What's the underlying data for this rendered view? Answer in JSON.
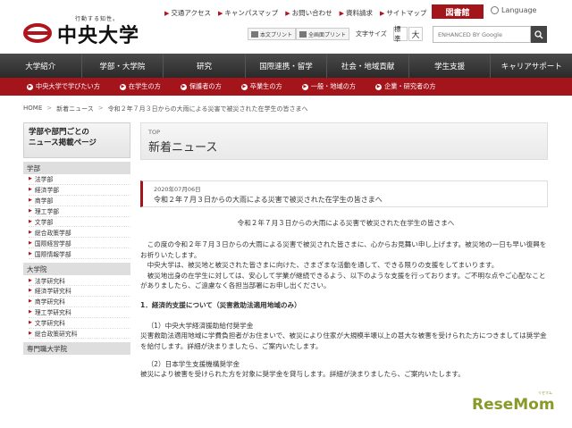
{
  "header": {
    "slogan": "行動する知性。",
    "university_name": "中央大学",
    "top_links": [
      "交通アクセス",
      "キャンパスマップ",
      "お問い合わせ",
      "資料請求",
      "サイトマップ"
    ],
    "library_button": "図書館",
    "language": "Language",
    "print_text_only": "本文プリント",
    "print_full": "全画面プリント",
    "font_size_label": "文字サイズ",
    "font_size_standard": "標準",
    "font_size_large": "大",
    "search_placeholder": "ENHANCED BY Google",
    "accent_color": "#a4141b"
  },
  "main_nav": [
    "大学紹介",
    "学部・大学院",
    "研究",
    "国際連携・留学",
    "社会・地域貢献",
    "学生支援",
    "キャリアサポート"
  ],
  "sub_nav": [
    "中央大学で学びたい方",
    "在学生の方",
    "保護者の方",
    "卒業生の方",
    "一般・地域の方",
    "企業・研究者の方"
  ],
  "breadcrumb": {
    "home": "HOME",
    "section": "新着ニュース",
    "current": "令和２年７月３日からの大雨による災害で被災された在学生の皆さまへ"
  },
  "sidebar": {
    "title_line1": "学部や部門ごとの",
    "title_line2": "ニュース掲載ページ",
    "groups": [
      {
        "heading": "学部",
        "items": [
          "法学部",
          "経済学部",
          "商学部",
          "理工学部",
          "文学部",
          "総合政策学部",
          "国際経営学部",
          "国際情報学部"
        ]
      },
      {
        "heading": "大学院",
        "items": [
          "法学研究科",
          "経済学研究科",
          "商学研究科",
          "理工学研究科",
          "文学研究科",
          "総合政策研究科"
        ]
      },
      {
        "heading": "専門職大学院",
        "items": []
      }
    ]
  },
  "main": {
    "top_label": "TOP",
    "page_title": "新着ニュース",
    "news_date": "2020年07月06日",
    "news_title": "令和２年７月３日からの大雨による災害で被災された在学生の皆さまへ",
    "body_title": "令和２年７月３日からの大雨による災害で被災された在学生の皆さまへ",
    "para1": "この度の令和２年７月３日からの大雨による災害で被災された皆さまに、心からお見舞い申し上げます。被災地の一日も早い復興をお祈りいたします。",
    "para2": "中央大学は、被災地と被災された皆さまに向けた、さまざまな活動を通して、できる限りの支援をしてまいります。",
    "para3": "被災地出身の在学生に対しては、安心して学業が継続できるよう、以下のような支援を行っております。ご不明な点やご心配なことがありましたら、ご遠慮なく各担当部署にお申し出ください。",
    "section1": "1．経済的支援について（災害救助法適用地域のみ）",
    "sub1_title": "（1）中央大学経済援助給付奨学金",
    "sub1_text": "災害救助法適用地域に学費負担者がお住まいで、被災により住家が大規模半壊以上の甚大な被害を受けられた方につきましては奨学金を給付します。詳細が決まりましたら、ご案内いたします。",
    "sub2_title": "（2）日本学生支援機構奨学金",
    "sub2_text": "被災により被害を受けられた方を対象に奨学金を貸与します。詳細が決まりましたら、ご案内いたします。"
  },
  "watermark": {
    "text": "ReseMom",
    "ruby": "リセマム"
  }
}
